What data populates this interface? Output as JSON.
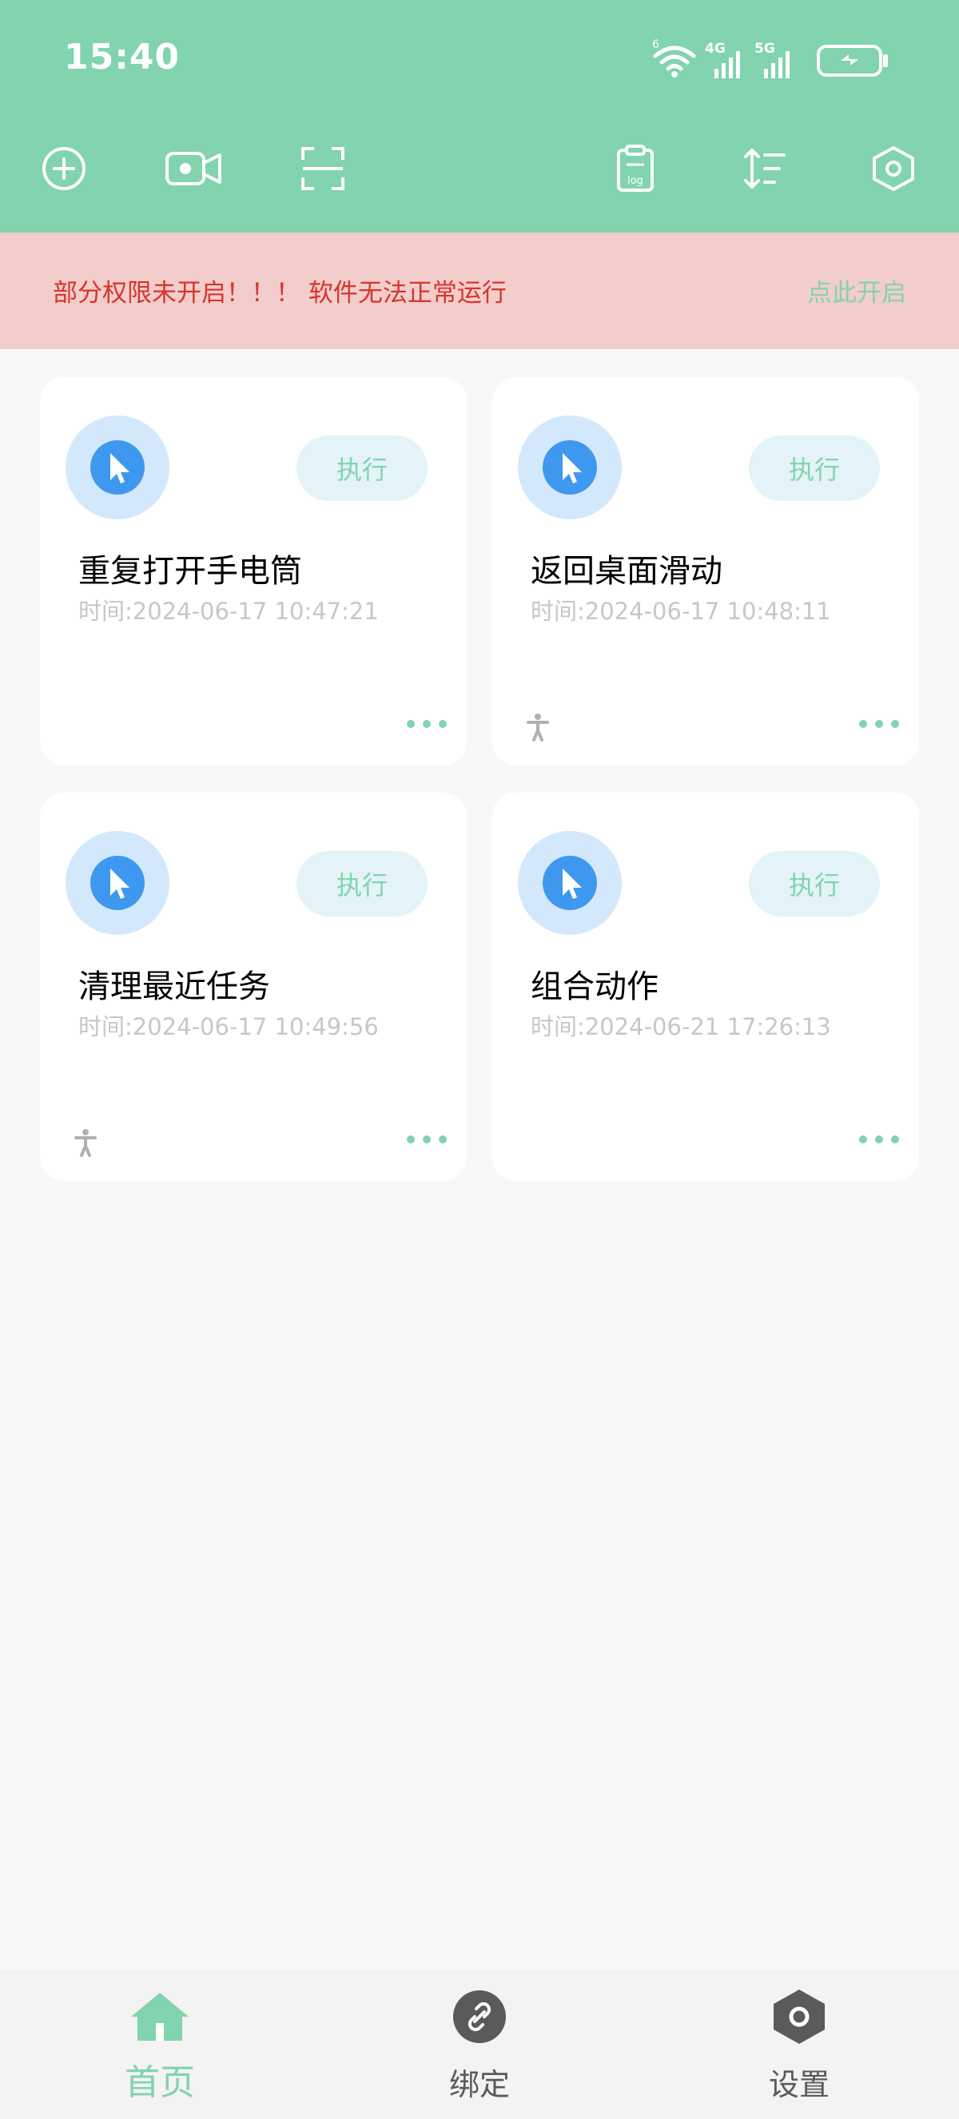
{
  "status_bar": {
    "time": "15:40",
    "network_labels": [
      "6",
      "4G",
      "5G"
    ]
  },
  "toolbar": {
    "icons": [
      "add-icon",
      "video-record-icon",
      "scan-icon",
      "log-clipboard-icon",
      "sort-icon",
      "settings-hex-icon"
    ],
    "log_label": "log"
  },
  "banner": {
    "message": "部分权限未开启！！！ 软件无法正常运行",
    "action": "点此开启"
  },
  "colors": {
    "primary": "#81d4ad",
    "banner_bg": "#f3cccc",
    "banner_text": "#d6362b",
    "icon_blue": "#3f98ef",
    "icon_bg": "#d3e8fb",
    "nav_inactive": "#5a5a5a"
  },
  "tasks": [
    {
      "title": "重复打开手电筒",
      "time": "时间:2024-06-17 10:47:21",
      "exec_label": "执行",
      "accessibility": false
    },
    {
      "title": "返回桌面滑动",
      "time": "时间:2024-06-17 10:48:11",
      "exec_label": "执行",
      "accessibility": true
    },
    {
      "title": "清理最近任务",
      "time": "时间:2024-06-17 10:49:56",
      "exec_label": "执行",
      "accessibility": true
    },
    {
      "title": "组合动作",
      "time": "时间:2024-06-21 17:26:13",
      "exec_label": "执行",
      "accessibility": false
    }
  ],
  "bottom_nav": {
    "items": [
      {
        "label": "首页",
        "icon": "home-icon",
        "active": true
      },
      {
        "label": "绑定",
        "icon": "link-icon",
        "active": false
      },
      {
        "label": "设置",
        "icon": "settings-icon",
        "active": false
      }
    ]
  }
}
